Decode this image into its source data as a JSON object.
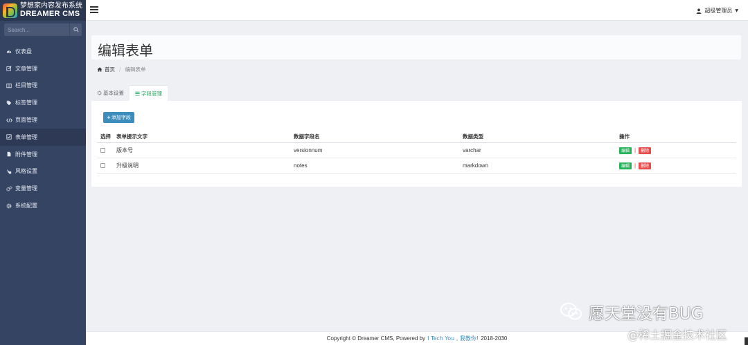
{
  "brand": {
    "name_cn": "梦想家内容发布系统",
    "name_en": "DREAMER CMS"
  },
  "search": {
    "placeholder": "Search..."
  },
  "sidebar": {
    "items": [
      {
        "label": "仪表盘",
        "icon": "dashboard-icon"
      },
      {
        "label": "文章管理",
        "icon": "edit-icon"
      },
      {
        "label": "栏目管理",
        "icon": "columns-icon"
      },
      {
        "label": "标签管理",
        "icon": "tags-icon"
      },
      {
        "label": "页面管理",
        "icon": "code-icon"
      },
      {
        "label": "表单管理",
        "icon": "check-square-icon"
      },
      {
        "label": "附件管理",
        "icon": "attachment-icon"
      },
      {
        "label": "风格设置",
        "icon": "palette-icon"
      },
      {
        "label": "变量管理",
        "icon": "cogs-icon"
      },
      {
        "label": "系统配置",
        "icon": "gear-icon"
      }
    ]
  },
  "header": {
    "user_name": "超级管理员"
  },
  "page": {
    "title": "编辑表单"
  },
  "breadcrumb": {
    "home": "首页",
    "current": "编辑表单"
  },
  "tabs": [
    {
      "label": "基本设置"
    },
    {
      "label": "字段管理"
    }
  ],
  "main": {
    "add_button": "添加字段",
    "columns": [
      "选择",
      "表单提示文字",
      "数据字段名",
      "数据类型",
      "操作"
    ],
    "rows": [
      {
        "label": "版本号",
        "field": "versionnum",
        "type": "varchar"
      },
      {
        "label": "升级说明",
        "field": "notes",
        "type": "markdown"
      }
    ],
    "edit_label": "编辑",
    "delete_label": "删除",
    "pipe": "|"
  },
  "footer": {
    "prefix": "Copyright © Dreamer CMS, Powered by",
    "link_text": "I Tech You , 我教你!",
    "suffix": "2018-2030"
  },
  "watermark": {
    "line1": "愿天堂没有BUG",
    "line2": "@稀土掘金技术社区"
  },
  "colors": {
    "sidebar_bg": "#364463",
    "primary": "#3c8dbc",
    "success": "#27b45a",
    "danger": "#e74c4c",
    "active_tab": "#27ae60"
  }
}
